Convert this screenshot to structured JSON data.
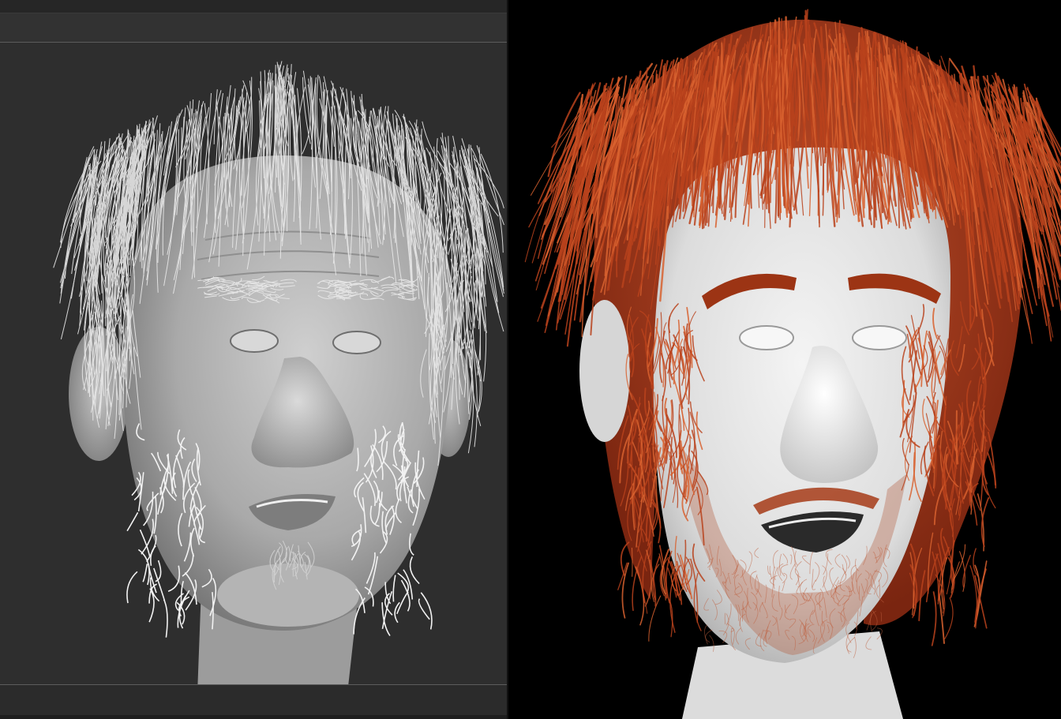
{
  "viewport": {
    "mode": "sculpt-clay-preview",
    "background": "#2f2f2f",
    "clay_color": "#b8b8b8",
    "fiber_color": "#e6e6e6"
  },
  "render": {
    "mode": "render-preview",
    "background": "#000000",
    "skin_color": "#e4e4e4",
    "hair_color": "#b8421c",
    "hair_highlight": "#d8612f"
  },
  "icons": {
    "viewport_model": "clay-head-with-fibermesh",
    "render_model": "rendered-head-with-red-hair"
  }
}
